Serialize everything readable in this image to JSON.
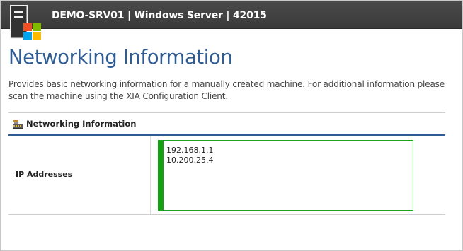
{
  "header": {
    "title": "DEMO-SRV01 | Windows Server | 42015",
    "logo_icon": "server-windows-logo-icon",
    "background": "#3f3f3f"
  },
  "page": {
    "title": "Networking Information",
    "description": "Provides basic networking information for a manually created machine. For additional information please scan the machine using the XIA Configuration Client.",
    "title_color": "#2f5c93"
  },
  "section": {
    "title": "Networking Information",
    "icon": "network-card-icon",
    "accent": "#2f5c93"
  },
  "table": {
    "rows": [
      {
        "label": "IP Addresses",
        "values": [
          "192.168.1.1",
          "10.200.25.4"
        ],
        "status_color": "#14a014"
      }
    ]
  }
}
